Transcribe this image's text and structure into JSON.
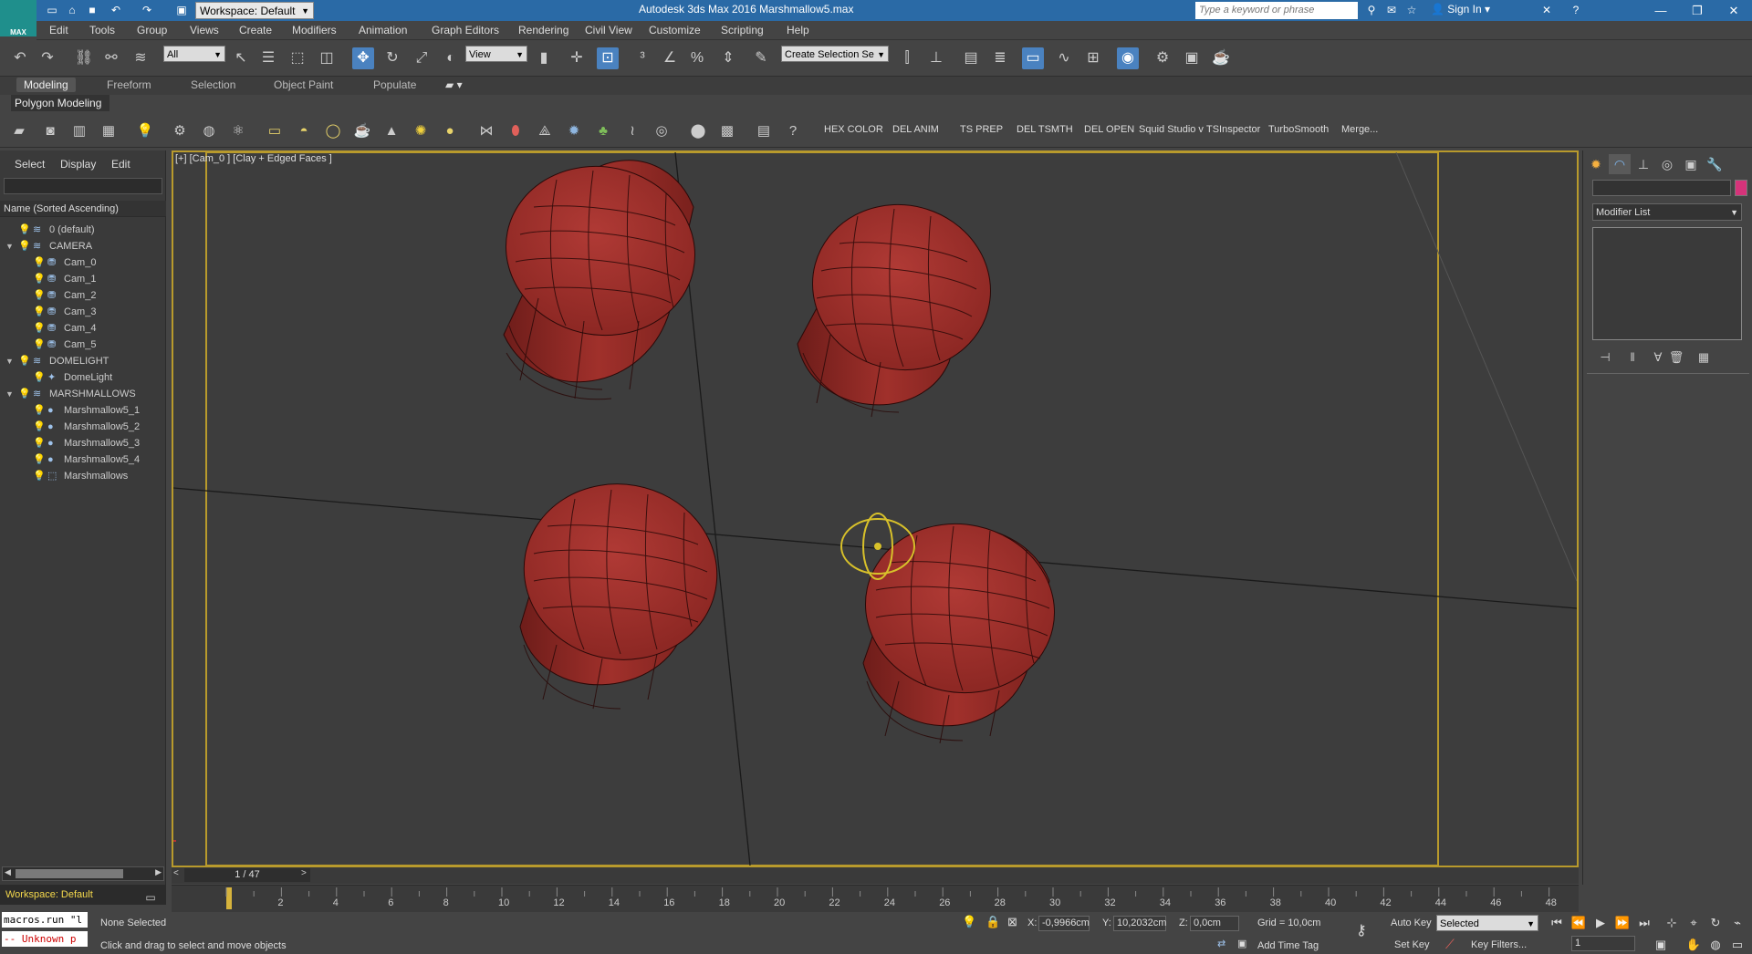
{
  "titlebar": {
    "app_title": "Autodesk 3ds Max 2016      Marshmallow5.max",
    "logo_text": "MAX",
    "workspace": "Workspace: Default",
    "search_placeholder": "Type a keyword or phrase",
    "sign_in": "Sign In"
  },
  "menu": [
    "Edit",
    "Tools",
    "Group",
    "Views",
    "Create",
    "Modifiers",
    "Animation",
    "Graph Editors",
    "Rendering",
    "Civil View",
    "Customize",
    "Scripting",
    "Help"
  ],
  "toolbar": {
    "selection_filter": "All",
    "ref_coord": "View",
    "named_selection": "Create Selection Se"
  },
  "ribbon": {
    "tabs": [
      "Modeling",
      "Freeform",
      "Selection",
      "Object Paint",
      "Populate"
    ],
    "active_tab": "Modeling",
    "panel_label": "Polygon Modeling"
  },
  "scripts": [
    "HEX COLOR",
    "DEL ANIM",
    "TS PREP",
    "DEL TSMTH",
    "DEL OPEN",
    "Squid Studio v",
    "TSInspector",
    "TurboSmooth",
    "Merge..."
  ],
  "explorer": {
    "tabs": [
      "Select",
      "Display",
      "Edit"
    ],
    "column_header": "Name (Sorted Ascending)",
    "rows": [
      {
        "label": "0 (default)",
        "level": 0,
        "expand": "",
        "icon": "layer"
      },
      {
        "label": "CAMERA",
        "level": 0,
        "expand": "▼",
        "icon": "layer"
      },
      {
        "label": "Cam_0",
        "level": 1,
        "expand": "",
        "icon": "camera"
      },
      {
        "label": "Cam_1",
        "level": 1,
        "expand": "",
        "icon": "camera"
      },
      {
        "label": "Cam_2",
        "level": 1,
        "expand": "",
        "icon": "camera"
      },
      {
        "label": "Cam_3",
        "level": 1,
        "expand": "",
        "icon": "camera"
      },
      {
        "label": "Cam_4",
        "level": 1,
        "expand": "",
        "icon": "camera"
      },
      {
        "label": "Cam_5",
        "level": 1,
        "expand": "",
        "icon": "camera"
      },
      {
        "label": "DOMELIGHT",
        "level": 0,
        "expand": "▼",
        "icon": "layer"
      },
      {
        "label": "DomeLight",
        "level": 1,
        "expand": "",
        "icon": "light"
      },
      {
        "label": "MARSHMALLOWS",
        "level": 0,
        "expand": "▼",
        "icon": "layer"
      },
      {
        "label": "Marshmallow5_1",
        "level": 1,
        "expand": "",
        "icon": "object"
      },
      {
        "label": "Marshmallow5_2",
        "level": 1,
        "expand": "",
        "icon": "object"
      },
      {
        "label": "Marshmallow5_3",
        "level": 1,
        "expand": "",
        "icon": "object"
      },
      {
        "label": "Marshmallow5_4",
        "level": 1,
        "expand": "",
        "icon": "object"
      },
      {
        "label": "Marshmallows",
        "level": 1,
        "expand": "",
        "icon": "group"
      }
    ]
  },
  "viewport": {
    "label": "[+] [Cam_0 ] [Clay + Edged Faces ]"
  },
  "command_panel": {
    "modifier_list": "Modifier List",
    "object_color": "#d6337a"
  },
  "timeline": {
    "frame_counter": "1 / 47",
    "ticks": [
      "2",
      "4",
      "6",
      "8",
      "10",
      "12",
      "14",
      "16",
      "18",
      "20",
      "22",
      "24",
      "26",
      "28",
      "30",
      "32",
      "34",
      "36",
      "38",
      "40",
      "42",
      "44",
      "46",
      "48"
    ],
    "workspace_label": "Workspace: Default"
  },
  "status": {
    "macro": "macros.run \"l",
    "unknown": "-- Unknown p",
    "selection": "None Selected",
    "prompt": "Click and drag to select and move objects",
    "x_label": "X:",
    "x": "-0,9966cm",
    "y_label": "Y:",
    "y": "10,2032cm",
    "z_label": "Z:",
    "z": "0,0cm",
    "grid": "Grid = 10,0cm",
    "auto_key": "Auto Key",
    "key_mode": "Selected",
    "set_key": "Set Key",
    "key_filters": "Key Filters...",
    "add_time_tag": "Add Time Tag",
    "current_frame": "1"
  },
  "colors": {
    "marshmallow": "#9c2b27",
    "selection": "#d8c12a",
    "accent": "#2a6aa6"
  }
}
